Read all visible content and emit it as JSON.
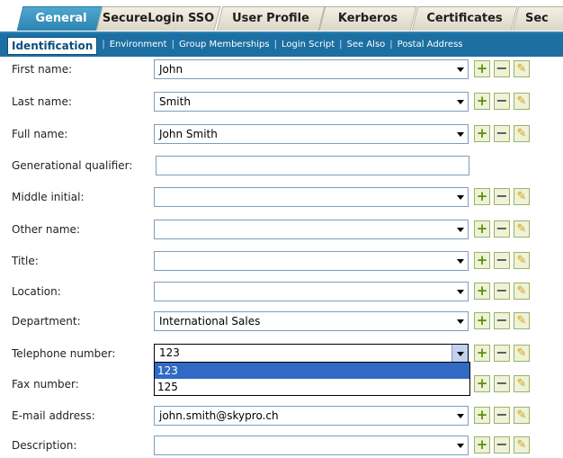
{
  "tabs": [
    "General",
    "SecureLogin SSO",
    "User Profile",
    "Kerberos",
    "Certificates",
    "Sec"
  ],
  "subnav": [
    "Identification",
    "Environment",
    "Group Memberships",
    "Login Script",
    "See Also",
    "Postal Address"
  ],
  "buttons": {
    "add": "+",
    "delete": "−",
    "edit": "✎"
  },
  "fields": [
    {
      "label": "First name:",
      "value": "John"
    },
    {
      "label": "Last name:",
      "value": "Smith"
    },
    {
      "label": "Full name:",
      "value": "John Smith"
    },
    {
      "label": "Generational qualifier:",
      "value": ""
    },
    {
      "label": "Middle initial:",
      "value": ""
    },
    {
      "label": "Other name:",
      "value": ""
    },
    {
      "label": "Title:",
      "value": ""
    },
    {
      "label": "Location:",
      "value": ""
    },
    {
      "label": "Department:",
      "value": "International Sales"
    },
    {
      "label": "Telephone number:",
      "value": "123"
    },
    {
      "label": "Fax number:",
      "value": ""
    },
    {
      "label": "E-mail address:",
      "value": "john.smith@skypro.ch"
    },
    {
      "label": "Description:",
      "value": ""
    }
  ],
  "telephone_dropdown": {
    "options": [
      "123",
      "125"
    ],
    "highlighted": "123"
  },
  "colors": {
    "active_tab": "#3a93c0",
    "subnav": "#1d6fa2",
    "selection": "#316ac5",
    "add_icon": "#5c8f0b"
  }
}
